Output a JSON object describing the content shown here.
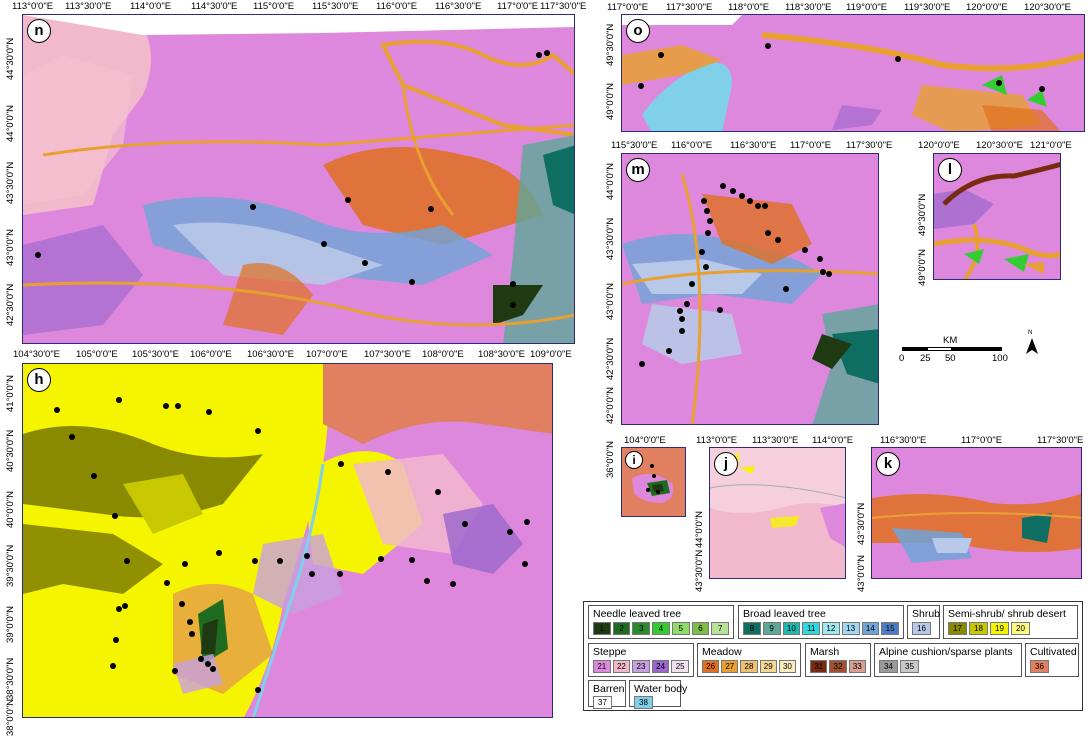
{
  "panels": {
    "n": {
      "label": "n",
      "xticks": [
        "113°0'0\"E",
        "113°30'0\"E",
        "114°0'0\"E",
        "114°30'0\"E",
        "115°0'0\"E",
        "115°30'0\"E",
        "116°0'0\"E",
        "116°30'0\"E",
        "117°0'0\"E",
        "117°30'0\"E"
      ],
      "yticks": [
        "44°30'0\"N",
        "44°0'0\"N",
        "43°30'0\"N",
        "43°0'0\"N",
        "42°30'0\"N"
      ]
    },
    "o": {
      "label": "o",
      "xticks": [
        "117°0'0\"E",
        "117°30'0\"E",
        "118°0'0\"E",
        "118°30'0\"E",
        "119°0'0\"E",
        "119°30'0\"E",
        "120°0'0\"E",
        "120°30'0\"E"
      ],
      "yticks": [
        "49°30'0\"N",
        "49°0'0\"N"
      ]
    },
    "m": {
      "label": "m",
      "xticks": [
        "115°30'0\"E",
        "116°0'0\"E",
        "116°30'0\"E",
        "117°0'0\"E",
        "117°30'0\"E"
      ],
      "yticks": [
        "44°0'0\"N",
        "43°30'0\"N",
        "43°0'0\"N",
        "42°30'0\"N",
        "42°0'0\"N"
      ]
    },
    "l": {
      "label": "l",
      "xticks": [
        "120°0'0\"E",
        "120°30'0\"E",
        "121°0'0\"E"
      ],
      "yticks": [
        "49°30'0\"N",
        "49°0'0\"N"
      ]
    },
    "h": {
      "label": "h",
      "xticks": [
        "104°30'0\"E",
        "105°0'0\"E",
        "105°30'0\"E",
        "106°0'0\"E",
        "106°30'0\"E",
        "107°0'0\"E",
        "107°30'0\"E",
        "108°0'0\"E",
        "108°30'0\"E",
        "109°0'0\"E"
      ],
      "yticks": [
        "41°0'0\"N",
        "40°30'0\"N",
        "40°0'0\"N",
        "39°30'0\"N",
        "39°0'0\"N",
        "38°30'0\"N",
        "38°0'0\"N"
      ]
    },
    "i": {
      "label": "i",
      "xticks": [
        "104°0'0\"E"
      ],
      "yticks": [
        "36°0'0\"N"
      ]
    },
    "j": {
      "label": "j",
      "xticks": [
        "113°0'0\"E",
        "113°30'0\"E",
        "114°0'0\"E"
      ],
      "yticks": [
        "44°0'0\"N",
        "43°30'0\"N"
      ]
    },
    "k": {
      "label": "k",
      "xticks": [
        "116°30'0\"E",
        "117°0'0\"E",
        "117°30'0\"E"
      ],
      "yticks": [
        "43°30'0\"N",
        "43°0'0\"N"
      ]
    }
  },
  "scale": {
    "unit": "KM",
    "labels": [
      "0",
      "25",
      "50",
      "100"
    ],
    "north": "N"
  },
  "legend": [
    {
      "title": "Needle leaved tree",
      "items": [
        {
          "n": "1",
          "color": "#1f3a12"
        },
        {
          "n": "2",
          "color": "#1f6b1f"
        },
        {
          "n": "3",
          "color": "#2b8a2b"
        },
        {
          "n": "4",
          "color": "#33cc33"
        },
        {
          "n": "5",
          "color": "#8fdc6a"
        },
        {
          "n": "6",
          "color": "#7ebc4a"
        },
        {
          "n": "7",
          "color": "#b8e29a"
        }
      ]
    },
    {
      "title": "Broad leaved tree",
      "items": [
        {
          "n": "8",
          "color": "#0f6e62"
        },
        {
          "n": "9",
          "color": "#5fa69a"
        },
        {
          "n": "10",
          "color": "#1fb8b0"
        },
        {
          "n": "11",
          "color": "#2fd9e0"
        },
        {
          "n": "12",
          "color": "#9fe8f0"
        },
        {
          "n": "13",
          "color": "#a0d8f2"
        },
        {
          "n": "14",
          "color": "#6fa5d8"
        },
        {
          "n": "15",
          "color": "#4b7cc4"
        }
      ]
    },
    {
      "title": "Shrub",
      "items": [
        {
          "n": "16",
          "color": "#b8c8e8"
        }
      ]
    },
    {
      "title": "Semi-shrub/ shrub desert",
      "items": [
        {
          "n": "17",
          "color": "#8a8a00"
        },
        {
          "n": "18",
          "color": "#c8c800"
        },
        {
          "n": "19",
          "color": "#f5f500"
        },
        {
          "n": "20",
          "color": "#fafa80"
        }
      ]
    },
    {
      "title": "Steppe",
      "items": [
        {
          "n": "21",
          "color": "#dd88dd"
        },
        {
          "n": "22",
          "color": "#f2b8cc"
        },
        {
          "n": "23",
          "color": "#c8a0e0"
        },
        {
          "n": "24",
          "color": "#9a66cc"
        },
        {
          "n": "25",
          "color": "#f0e0f0"
        }
      ]
    },
    {
      "title": "Meadow",
      "items": [
        {
          "n": "26",
          "color": "#e07020"
        },
        {
          "n": "27",
          "color": "#e8a030"
        },
        {
          "n": "28",
          "color": "#f0c070"
        },
        {
          "n": "29",
          "color": "#f5d890"
        },
        {
          "n": "30",
          "color": "#faeec0"
        }
      ]
    },
    {
      "title": "Marsh",
      "items": [
        {
          "n": "31",
          "color": "#7a2a10"
        },
        {
          "n": "32",
          "color": "#a05030"
        },
        {
          "n": "33",
          "color": "#d8a090"
        }
      ]
    },
    {
      "title": "Alpine cushion/sparse plants",
      "items": [
        {
          "n": "34",
          "color": "#9a9a9a"
        },
        {
          "n": "35",
          "color": "#c8c8c8"
        }
      ]
    },
    {
      "title": "Cultivated",
      "items": [
        {
          "n": "36",
          "color": "#e08060"
        }
      ]
    },
    {
      "title": "Barren",
      "items": [
        {
          "n": "37",
          "color": "#ffffff"
        }
      ]
    },
    {
      "title": "Water body",
      "items": [
        {
          "n": "38",
          "color": "#7fd0e8"
        }
      ]
    }
  ]
}
